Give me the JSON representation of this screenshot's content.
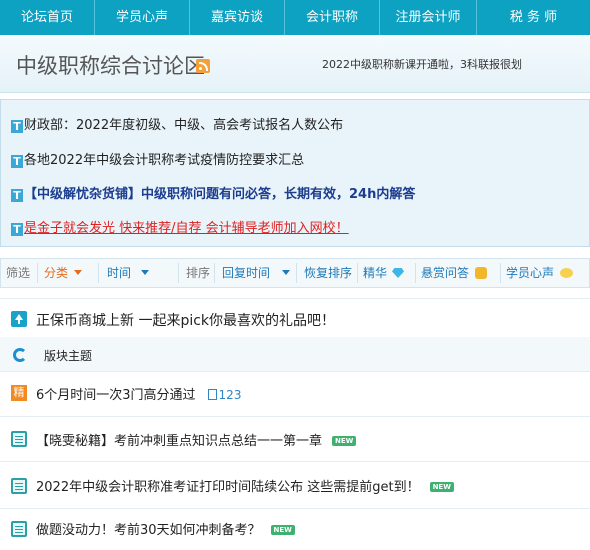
{
  "nav": [
    "论坛首页",
    "学员心声",
    "嘉宾访谈",
    "会计职称",
    "注册会计师",
    "税 务 师"
  ],
  "header": {
    "title": "中级职称综合讨论区",
    "marquee": "2022中级职称新课开通啦，3科联报很划"
  },
  "notices": [
    "财政部：2022年度初级、中级、高会考试报名人数公布",
    "各地2022年中级会计职称考试疫情防控要求汇总",
    "【中级解忧杂货铺】中级职称问题有问必答，长期有效，24h内解答",
    "是金子就会发光 快来推荐/自荐 会计辅导老师加入网校！"
  ],
  "filter": {
    "filter_label": "筛选",
    "category": "分类",
    "time": "时间",
    "sort_label": "排序",
    "reply_time": "回复时间",
    "restore_sort": "恢复排序",
    "featured": "精华",
    "bounty": "悬赏问答",
    "student_voice": "学员心声"
  },
  "announcement": "正保币商城上新 一起来pick你最喜欢的礼品吧！",
  "section_label": "版块主题",
  "threads": [
    {
      "icon": "jing",
      "title": "6个月时间一次3门高分通过",
      "pages": "123",
      "new": false
    },
    {
      "icon": "doc",
      "title": "【晓雯秘籍】考前冲刺重点知识点总结一一第一章",
      "new": true
    },
    {
      "icon": "doc",
      "title": "2022年中级会计职称准考证打印时间陆续公布 这些需提前get到！",
      "new": true
    },
    {
      "icon": "doc",
      "title": "做题没动力！考前30天如何冲刺备考？",
      "new": true
    }
  ],
  "new_badge": "NEW",
  "jing_char": "精",
  "t_char": "T",
  "colors": {
    "nav_bg": "#0ea2c2",
    "accent_orange": "#e56d1b",
    "link_blue": "#1f7ab8",
    "notice_red": "#e02020"
  }
}
